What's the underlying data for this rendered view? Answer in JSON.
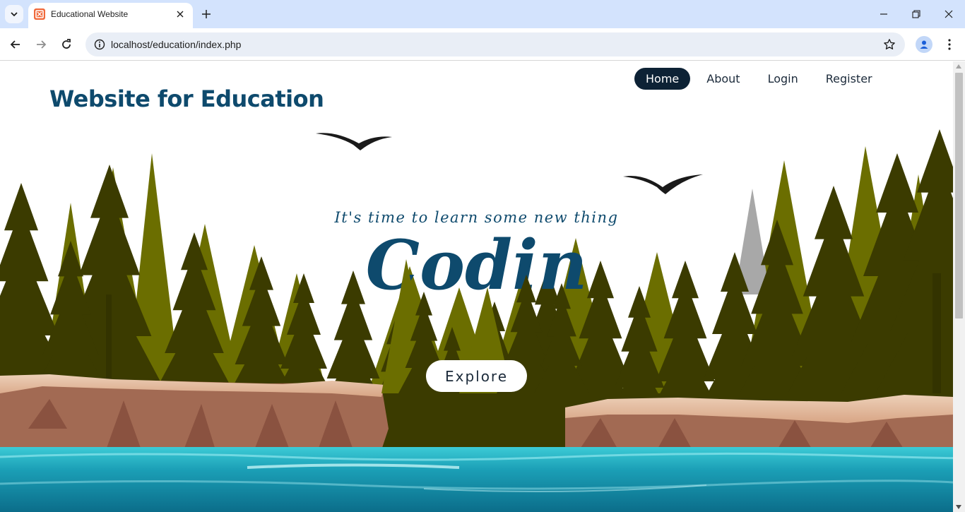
{
  "browser": {
    "tab_title": "Educational Website",
    "url": "localhost/education/index.php"
  },
  "site": {
    "title": "Website for Education",
    "nav": [
      "Home",
      "About",
      "Login",
      "Register"
    ],
    "active_nav": "Home",
    "tagline": "It's time to learn some new thing",
    "headline_partial": "Codin",
    "cta_label": "Explore"
  },
  "colors": {
    "brand": "#0e4a6d",
    "nav_active_bg": "#0d2235",
    "tree_light": "#6b6e00",
    "tree_dark": "#3b3b00",
    "water": "#1fa6b8",
    "cliff": "#e7c2a4"
  }
}
